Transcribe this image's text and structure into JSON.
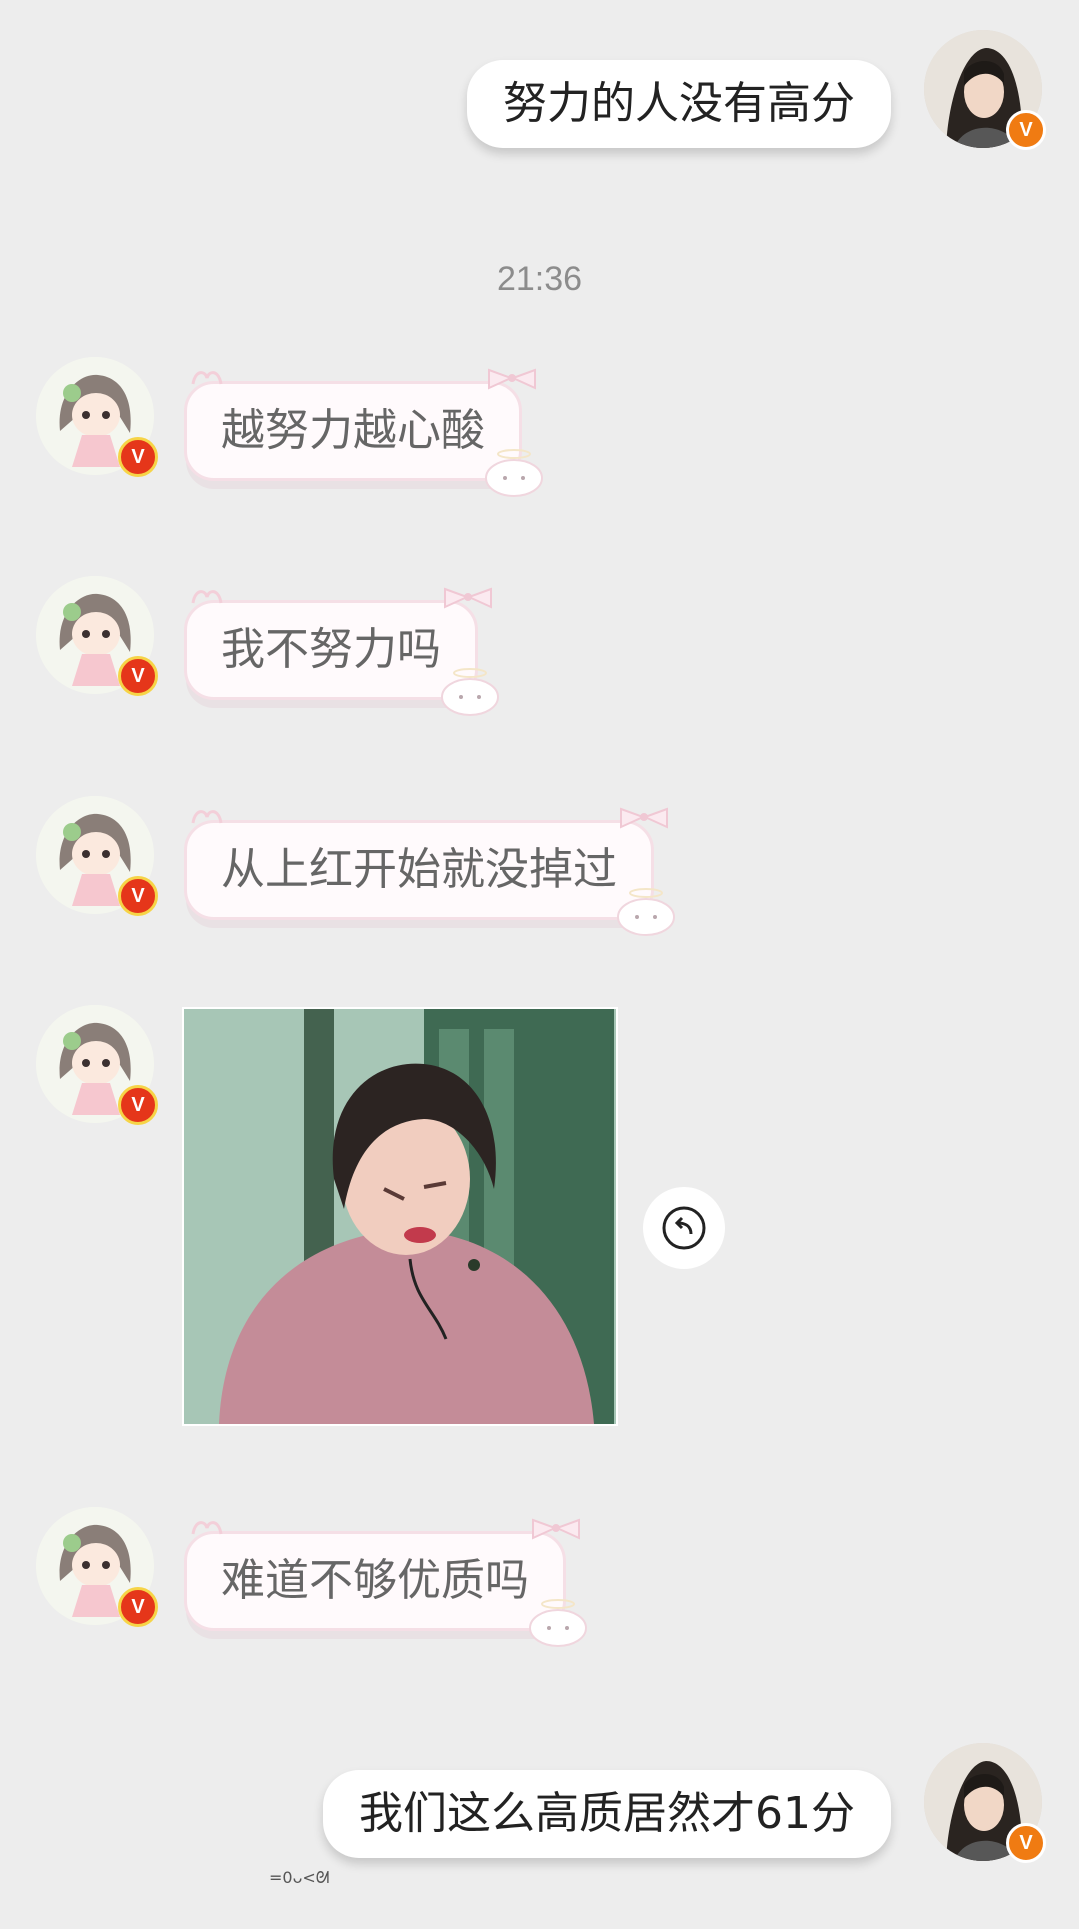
{
  "messages": [
    {
      "side": "out",
      "text": "努力的人没有高分"
    },
    {
      "side": "in",
      "text": "越努力越心酸"
    },
    {
      "side": "in",
      "text": "我不努力吗"
    },
    {
      "side": "in",
      "text": "从上红开始就没掉过"
    },
    {
      "side": "in",
      "type": "sticker",
      "description": "gif-sticker"
    },
    {
      "side": "in",
      "text": "难道不够优质吗"
    },
    {
      "side": "out",
      "text": "我们这么高质居然才61分"
    }
  ],
  "timestamp": "21:36",
  "badge_letter": "V",
  "caption": "=0ᴗ<ᘛ",
  "colors": {
    "background": "#ededed",
    "self_badge": "#f07b12",
    "other_badge": "#e5361a",
    "pink_border": "#f5dfe6"
  }
}
